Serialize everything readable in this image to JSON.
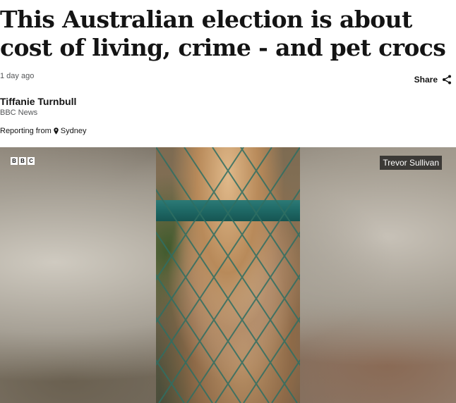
{
  "article": {
    "headline": "This Australian election is about cost of living, crime - and pet crocs",
    "timestamp": "1 day ago",
    "share_label": "Share",
    "author_name": "Tiffanie Turnbull",
    "author_org": "BBC News",
    "reporting_prefix": "Reporting from",
    "location": "Sydney"
  },
  "media": {
    "logo_letters": [
      "B",
      "B",
      "C"
    ],
    "credit": "Trevor Sullivan"
  },
  "colors": {
    "text": "#141414",
    "muted": "#545658",
    "fence_rail": "#1f6a67"
  },
  "icons": {
    "share": "share-icon",
    "location": "location-pin-icon"
  }
}
